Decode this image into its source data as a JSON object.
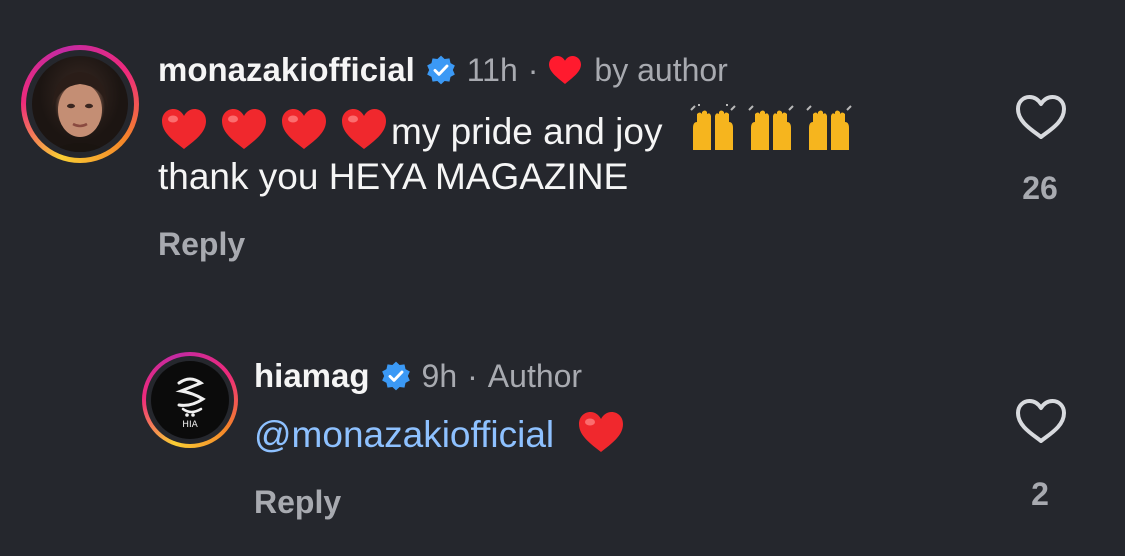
{
  "comment": {
    "username": "monazakiofficial",
    "time": "11h",
    "liked_by_author_label": "by author",
    "text_line1": "my pride and joy",
    "text_line2": "thank you HEYA MAGAZINE",
    "reply_label": "Reply",
    "like_count": "26"
  },
  "reply": {
    "username": "hiamag",
    "time": "9h",
    "role_label": "Author",
    "mention": "@monazakiofficial",
    "reply_label": "Reply",
    "like_count": "2",
    "avatar_logo_text": "HIA"
  },
  "colors": {
    "background": "#25272d",
    "verified": "#3b99f5",
    "heart": "#ff2a2a",
    "mention": "#8ec1ff",
    "muted": "#a8aab0"
  },
  "icons": {
    "verified": "verified-badge-icon",
    "like": "heart-outline-icon",
    "author_heart": "heart-filled-icon",
    "emoji_heart": "red-heart-emoji",
    "emoji_hands": "raising-hands-emoji"
  }
}
